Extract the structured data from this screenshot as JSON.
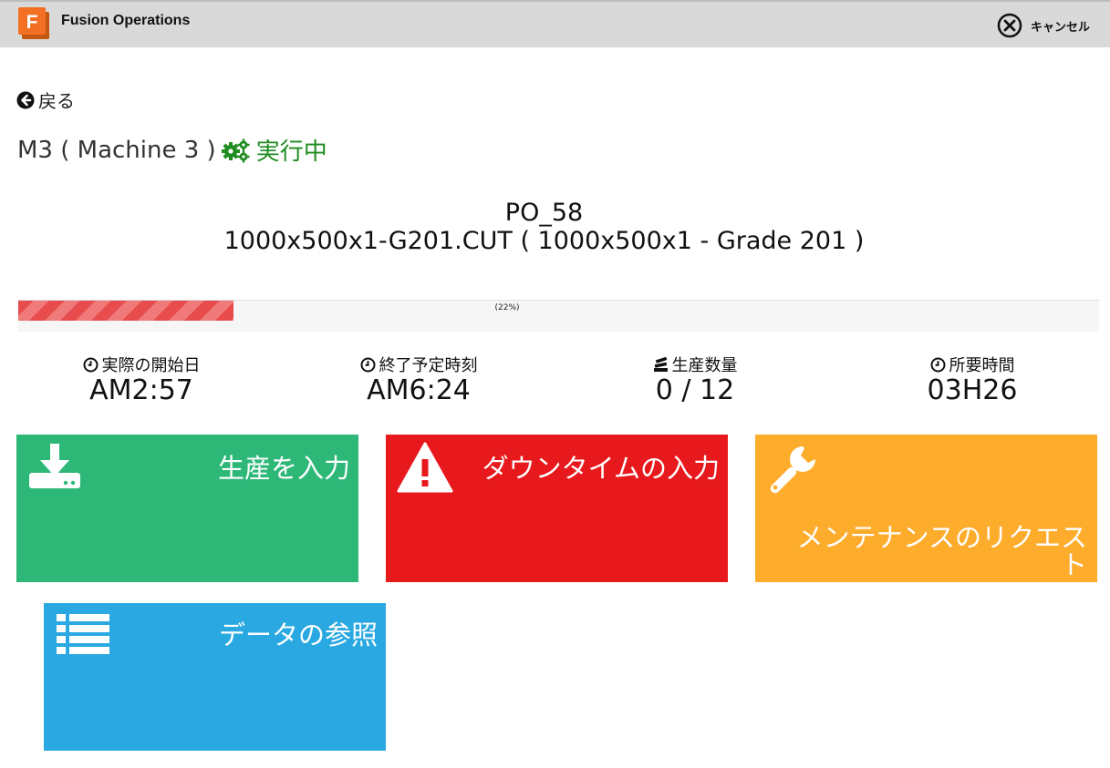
{
  "app": {
    "title": "Fusion Operations",
    "logo_letter": "F"
  },
  "header": {
    "cancel_label": "キャンセル"
  },
  "nav": {
    "back_label": "戻る"
  },
  "machine": {
    "name": "M3 ( Machine 3 )",
    "status": "実行中",
    "status_color": "#1f8c1f"
  },
  "order": {
    "po": "PO_58",
    "part": "1000x500x1-G201.CUT ( 1000x500x1 - Grade 201 )"
  },
  "progress": {
    "value": 0.22,
    "label": "(22%)"
  },
  "stats": [
    {
      "label": "実際の開始日",
      "value": "AM2:57",
      "icon": "clock-icon"
    },
    {
      "label": "終了予定時刻",
      "value": "AM6:24",
      "icon": "clock-icon"
    },
    {
      "label": "生産数量",
      "value": "0 / 12",
      "icon": "stack-icon"
    },
    {
      "label": "所要時間",
      "value": "03H26",
      "icon": "clock-icon"
    }
  ],
  "tiles": [
    {
      "label": "生産を入力",
      "icon": "download-icon",
      "color": "#2eb878"
    },
    {
      "label": "ダウンタイムの入力",
      "icon": "warning-icon",
      "color": "#e8191c"
    },
    {
      "label_line1": "メンテナンスのリクエス",
      "label_line2": "ト",
      "icon": "wrench-icon",
      "color": "#feac2c"
    },
    {
      "label": "データの参照",
      "icon": "list-icon",
      "color": "#29a8e1"
    }
  ]
}
